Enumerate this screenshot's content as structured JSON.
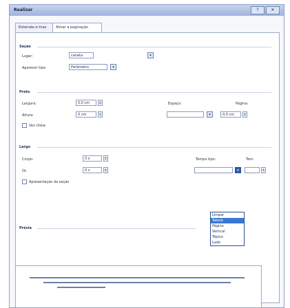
{
  "window": {
    "title": "Realizar",
    "buttons": [
      "?",
      "✕"
    ]
  },
  "tabs": [
    {
      "label": "Extensão e tiras",
      "active": false
    },
    {
      "label": "Ativar a paginação",
      "active": true
    }
  ],
  "sections": {
    "a": {
      "title": "Seção"
    },
    "b": {
      "title": "Preto"
    },
    "c": {
      "title": "Largo"
    },
    "d": {
      "title": "Prévia"
    }
  },
  "fields": {
    "f1": {
      "label": "Lugar:",
      "value": "caneta"
    },
    "f2": {
      "label": "Aparecer tipo:",
      "value": "Parâmetro"
    },
    "f3": {
      "label": "Largura:",
      "value": "0,0 cm"
    },
    "f4": {
      "label": "Altura:",
      "value": "0 cm"
    },
    "f5": {
      "label": "Espaço:",
      "value": ""
    },
    "f6": {
      "label": "Página:",
      "value": "0,0 cm"
    },
    "f7": {
      "label": "Corpo:",
      "value": "0 s"
    },
    "f8": {
      "label": "Oi:",
      "value": "0 s"
    },
    "f9": {
      "label": "Tempo tipo:",
      "value": ""
    },
    "f10": {
      "label": "Tem:",
      "value": ""
    }
  },
  "dropdown": {
    "options": [
      "Limpar",
      "Tabela",
      "Página",
      "Vertical",
      "Tópico",
      "Lado"
    ],
    "selected_index": 1
  },
  "checkboxes": {
    "c1": {
      "label": "Vez cheia",
      "checked": false
    },
    "c2": {
      "label": "Apresentação da seção",
      "checked": false
    }
  }
}
